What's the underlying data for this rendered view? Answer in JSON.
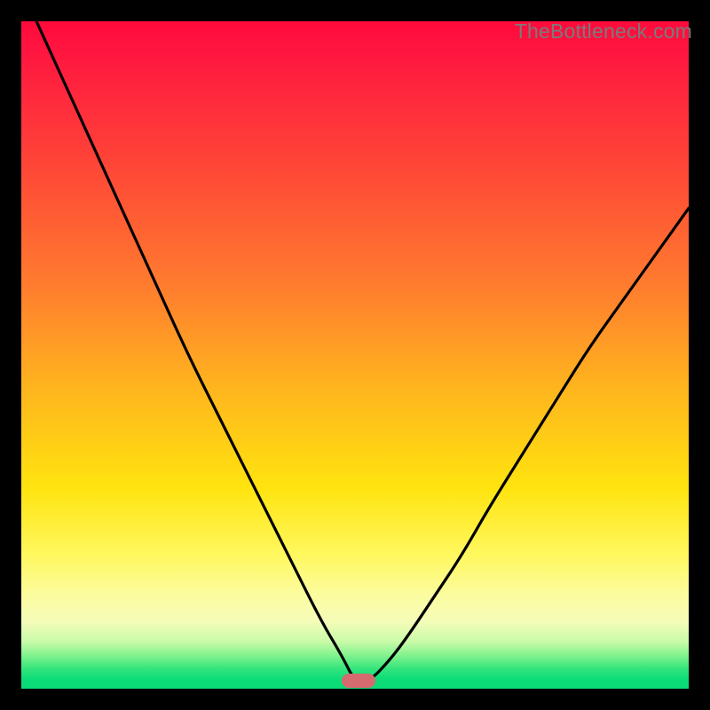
{
  "watermark": "TheBottleneck.com",
  "colors": {
    "frame": "#000000",
    "curve": "#000000",
    "marker": "#d56a6f",
    "watermark_text": "#7a7a7a",
    "gradient_top": "#ff0a3c",
    "gradient_bottom": "#0adb77"
  },
  "chart_data": {
    "type": "line",
    "title": "",
    "xlabel": "",
    "ylabel": "",
    "xlim": [
      0,
      100
    ],
    "ylim": [
      0,
      100
    ],
    "series": [
      {
        "name": "bottleneck-curve",
        "x": [
          0,
          5,
          10,
          15,
          20,
          25,
          30,
          35,
          40,
          45,
          48,
          50,
          52,
          55,
          58,
          62,
          66,
          70,
          75,
          80,
          85,
          90,
          95,
          100
        ],
        "y": [
          105,
          94,
          83,
          72,
          61,
          50,
          40,
          30,
          20,
          10,
          5,
          1,
          1,
          4,
          8,
          14,
          20,
          27,
          35,
          43,
          51,
          58,
          65,
          72
        ]
      }
    ],
    "annotations": [
      {
        "name": "min-marker",
        "x": 50.5,
        "y": 1.2,
        "shape": "pill",
        "color": "#d56a6f"
      }
    ],
    "background_gradient": {
      "orientation": "vertical",
      "stops": [
        {
          "pos": 0.0,
          "color": "#ff0a3c"
        },
        {
          "pos": 0.2,
          "color": "#ff4138"
        },
        {
          "pos": 0.4,
          "color": "#ff7d2e"
        },
        {
          "pos": 0.55,
          "color": "#ffb51e"
        },
        {
          "pos": 0.7,
          "color": "#ffe40f"
        },
        {
          "pos": 0.86,
          "color": "#fcfca0"
        },
        {
          "pos": 0.95,
          "color": "#82f28e"
        },
        {
          "pos": 1.0,
          "color": "#0adb77"
        }
      ]
    }
  }
}
